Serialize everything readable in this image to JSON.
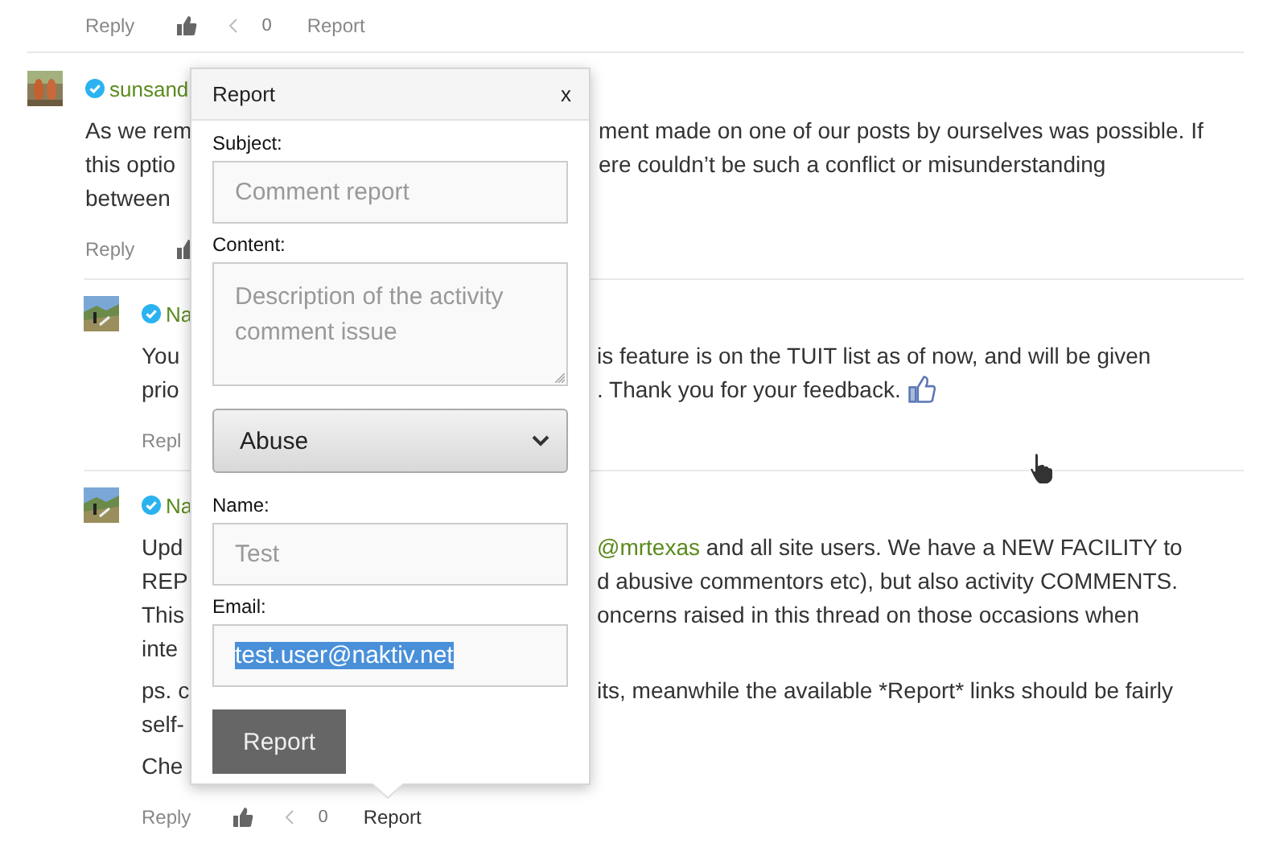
{
  "previous_actions": [
    {
      "kind": "reply",
      "label": "Reply"
    },
    {
      "kind": "like"
    },
    {
      "kind": "prev"
    },
    {
      "kind": "count",
      "label": "0"
    },
    {
      "kind": "report",
      "label": "Report"
    }
  ],
  "comments": [
    {
      "author": "sunsand",
      "verified": true,
      "nested": false,
      "paragraphs": [
        [
          {
            "left": "As we rem",
            "right": "ment made on one of our posts by ourselves was possible. If"
          },
          {
            "left": "this optio",
            "right": "ere couldn’t be such a conflict or misunderstanding"
          },
          {
            "left": "between"
          }
        ]
      ],
      "actions": [
        {
          "kind": "reply",
          "label": "Reply"
        },
        {
          "kind": "like"
        }
      ]
    },
    {
      "author": "Na",
      "verified": true,
      "nested": true,
      "paragraphs": [
        [
          {
            "left": "You",
            "right": "is feature is on the TUIT list as of now, and will be given"
          },
          {
            "left": "prio",
            "right": ". Thank you for your feedback.",
            "emoticon": true
          }
        ]
      ],
      "actions": [
        {
          "kind": "reply",
          "label": "Repl"
        }
      ]
    },
    {
      "author": "Na",
      "verified": true,
      "nested": true,
      "paragraphs": [
        [
          {
            "left": "Upd",
            "mention": "@mrtexas",
            "right": " and all site users. We have a NEW FACILITY to"
          },
          {
            "left": "REP",
            "right": "d abusive commentors etc), but also activity COMMENTS."
          },
          {
            "left": "This",
            "right": "oncerns raised in this thread on those occasions when"
          },
          {
            "left": "inte"
          }
        ],
        [
          {
            "left": "ps. c",
            "right": "its, meanwhile the available *Report* links should be fairly"
          },
          {
            "left": "self-"
          }
        ],
        [
          {
            "left": "Che"
          }
        ]
      ],
      "actions": [
        {
          "kind": "reply",
          "label": "Reply"
        },
        {
          "kind": "like"
        },
        {
          "kind": "prev"
        },
        {
          "kind": "count",
          "label": "0"
        },
        {
          "kind": "report",
          "label": "Report"
        }
      ]
    }
  ],
  "report_dialog": {
    "title": "Report",
    "close": "x",
    "fields": [
      {
        "kind": "input",
        "label": "Subject:",
        "placeholder": "Comment report"
      },
      {
        "kind": "textarea",
        "label": "Content:",
        "placeholder": "Description of the activity comment issue"
      },
      {
        "kind": "select",
        "value": "Abuse"
      },
      {
        "kind": "input",
        "label": "Name:",
        "placeholder": "Test"
      },
      {
        "kind": "input",
        "label": "Email:",
        "value": "test.user@naktiv.net",
        "selected": true
      }
    ],
    "submit": "Report"
  }
}
